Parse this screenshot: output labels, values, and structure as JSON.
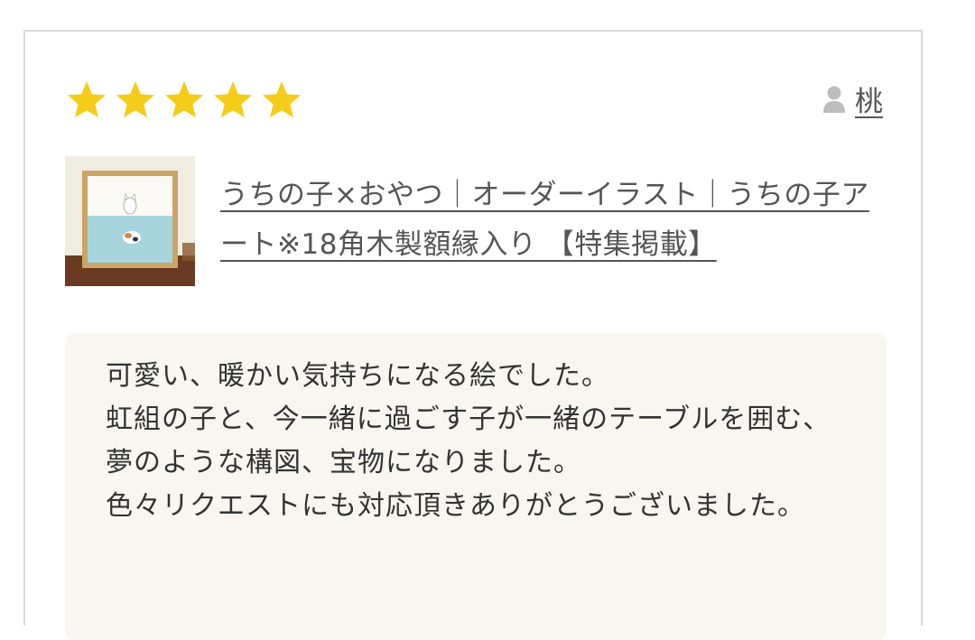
{
  "review": {
    "rating": 5,
    "max_rating": 5,
    "star_color": "#f5cc1a",
    "user_icon": "person-icon",
    "user_name": "桃",
    "product_title": "うちの子×おやつ｜オーダーイラスト｜うちの子アート※18角木製額縁入り 【特集掲載】",
    "body": "可愛い、暖かい気持ちになる絵でした。\n虹組の子と、今一緒に過ごす子が一緒のテーブルを囲む、夢のような構図、宝物になりました。\n色々リクエストにも対応頂きありがとうございました。"
  }
}
